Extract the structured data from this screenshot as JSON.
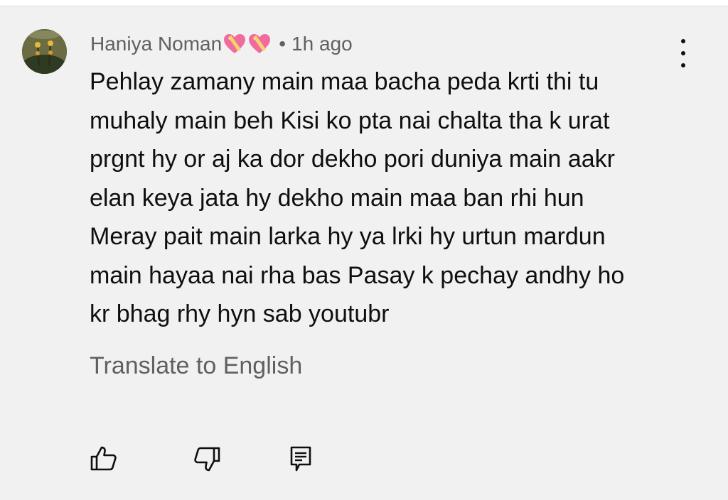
{
  "comment": {
    "author": "Haniya Noman",
    "author_badges": [
      "sparkling-heart-icon",
      "sparkling-heart-icon"
    ],
    "separator": "•",
    "timestamp": "1h ago",
    "lines": [
      "Pehlay zamany main maa bacha peda krti thi tu",
      "muhaly main beh Kisi ko pta nai chalta tha k urat",
      "prgnt hy or aj ka dor dekho pori duniya main aakr",
      "elan keya jata hy dekho main maa ban rhi hun",
      "Meray pait main larka hy ya lrki hy urtun mardun",
      "main hayaa nai rha bas Pasay k pechay andhy ho",
      "kr bhag rhy hyn sab youtubr"
    ],
    "translate_label": "Translate to English"
  },
  "actions": {
    "like_icon": "thumbs-up-icon",
    "dislike_icon": "thumbs-down-icon",
    "reply_icon": "reply-comment-icon",
    "more_icon": "more-vert-icon"
  },
  "colors": {
    "background": "#f1f1f1",
    "primary_text": "#0f0f0f",
    "secondary_text": "#606060",
    "heart": "#f06b9e"
  }
}
